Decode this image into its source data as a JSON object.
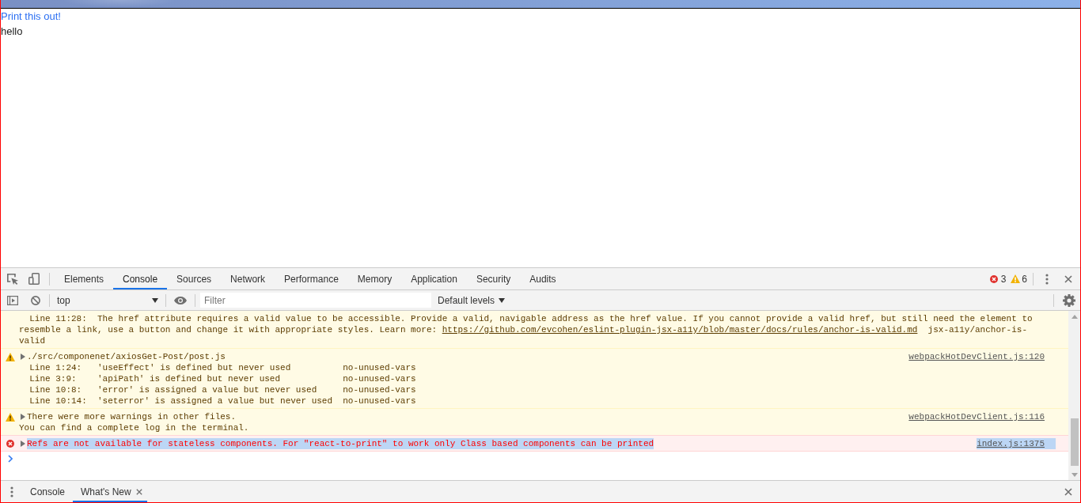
{
  "page": {
    "link": "Print this out!",
    "text": "hello"
  },
  "devtools": {
    "tabs": [
      {
        "label": "Elements",
        "selected": false
      },
      {
        "label": "Console",
        "selected": true
      },
      {
        "label": "Sources",
        "selected": false
      },
      {
        "label": "Network",
        "selected": false
      },
      {
        "label": "Performance",
        "selected": false
      },
      {
        "label": "Memory",
        "selected": false
      },
      {
        "label": "Application",
        "selected": false
      },
      {
        "label": "Security",
        "selected": false
      },
      {
        "label": "Audits",
        "selected": false
      }
    ],
    "counts": {
      "errors": "3",
      "warnings": "6"
    },
    "toolbar": {
      "context": "top",
      "filter": {
        "placeholder": "Filter"
      },
      "levels": "Default levels"
    },
    "messages": [
      {
        "kind": "warning",
        "highlighted": false,
        "body": {
          "before": "Line 11:28:  The href attribute requires a valid value to be accessible. Provide a valid, navigable address as the href value. If you cannot provide a valid href, but still need the element to resemble a link, use a button and change it with appropriate styles. Learn more: ",
          "link": "https://github.com/evcohen/eslint-plugin-jsx-a11y/blob/master/docs/rules/anchor-is-valid.md",
          "after": "  jsx-a11y/anchor-is-valid"
        }
      },
      {
        "kind": "warning",
        "expanded": false,
        "highlighted": false,
        "summary": "./src/componenet/axiosGet-Post/post.js",
        "source": "webpackHotDevClient.js:120",
        "lint": [
          {
            "location": "Line 1:24:",
            "message": "'useEffect' is defined but never used",
            "rule": "no-unused-vars"
          },
          {
            "location": "Line 3:9:",
            "message": "'apiPath' is defined but never used",
            "rule": "no-unused-vars"
          },
          {
            "location": "Line 10:8:",
            "message": "'error' is assigned a value but never used",
            "rule": "no-unused-vars"
          },
          {
            "location": "Line 10:14:",
            "message": "'seterror' is assigned a value but never used",
            "rule": "no-unused-vars"
          }
        ]
      },
      {
        "kind": "warning",
        "expanded": false,
        "highlighted": false,
        "summary": "There were more warnings in other files.",
        "source": "webpackHotDevClient.js:116",
        "note": "You can find a complete log in the terminal."
      },
      {
        "kind": "error",
        "expanded": false,
        "highlighted": true,
        "summary": "Refs are not available for stateless components. For \"react-to-print\" to work only Class based components can be printed",
        "source": "index.js:1375"
      }
    ],
    "drawer_tabs": [
      {
        "label": "Console",
        "selected": false,
        "closable": false
      },
      {
        "label": "What's New",
        "selected": true,
        "closable": true
      }
    ]
  }
}
